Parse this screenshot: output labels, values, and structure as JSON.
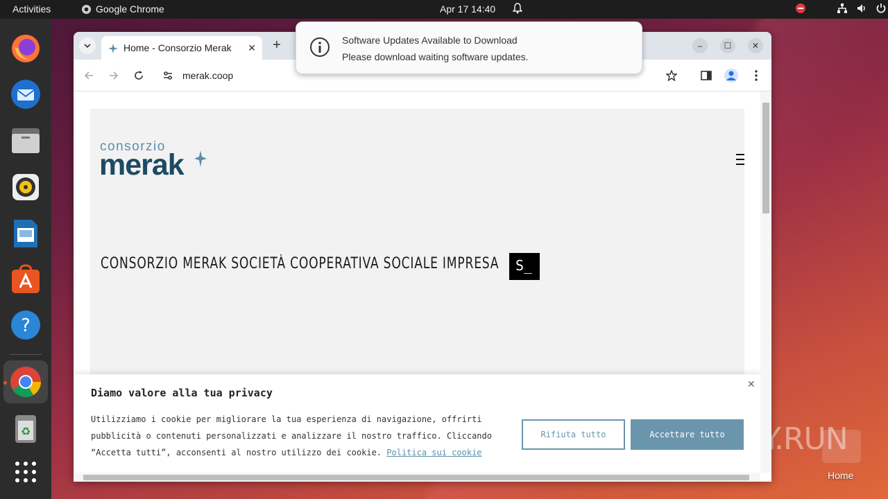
{
  "topbar": {
    "activities": "Activities",
    "app_name": "Google Chrome",
    "clock": "Apr 17  14:40"
  },
  "dock": {
    "items": [
      "Firefox",
      "Thunderbird",
      "Files",
      "Rhythmbox",
      "LibreOffice Impress",
      "Ubuntu Software",
      "Help",
      "Google Chrome",
      "Trash",
      "Show Applications"
    ]
  },
  "browser": {
    "tab_title": "Home - Consorzio Merak",
    "url": "merak.coop"
  },
  "notification": {
    "title": "Software Updates Available to Download",
    "body": "Please download waiting software updates."
  },
  "page": {
    "logo_top": "consorzio",
    "logo_main": "merak",
    "tagline": "CONSORZIO MERAK SOCIETÀ COOPERATIVA SOCIALE IMPRESA",
    "typing_text": "S_"
  },
  "cookie": {
    "title": "Diamo valore alla tua privacy",
    "text": "Utilizziamo i cookie per migliorare la tua esperienza di navigazione, offrirti pubblicità o contenuti personalizzati e analizzare il nostro traffico. Cliccando “Accetta tutti”, acconsenti al nostro utilizzo dei cookie.",
    "policy_link": "Politica sui cookie",
    "reject_label": "Rifiuta tutto",
    "accept_label": "Accettare tutto"
  },
  "desktop": {
    "home_label": "Home",
    "watermark": "ANY.RUN"
  },
  "colors": {
    "accent": "#6a95ad",
    "logo_dark": "#1e4a63",
    "ubuntu_orange": "#e95420"
  }
}
